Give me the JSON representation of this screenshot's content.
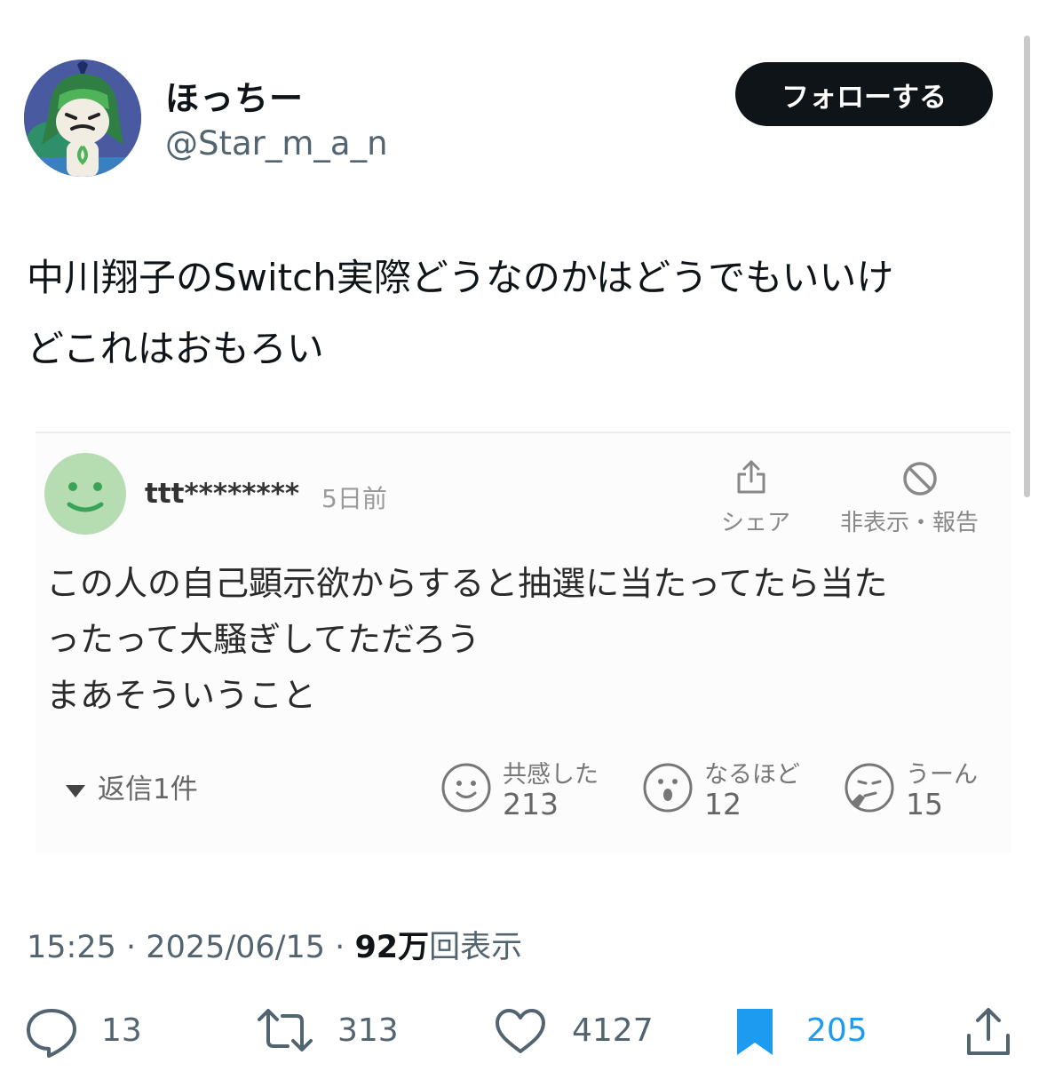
{
  "author": {
    "display_name": "ほっちー",
    "handle": "@Star_m_a_n",
    "follow_label": "フォローする"
  },
  "tweet": {
    "text_lines": [
      "中川翔子のSwitch実際どうなのかはどうでもいいけ",
      "どこれはおもろい"
    ]
  },
  "embedded_comment": {
    "username": "ttt********",
    "time": "5日前",
    "share_label": "シェア",
    "report_label": "非表示・報告",
    "body_lines": [
      "この人の自己顕示欲からすると抽選に当たってたら当た",
      "ったって大騒ぎしてただろう",
      "まあそういうこと"
    ],
    "replies_label": "返信1件",
    "reactions": [
      {
        "label": "共感した",
        "count": "213",
        "icon": "smile-icon"
      },
      {
        "label": "なるほど",
        "count": "12",
        "icon": "surprised-icon"
      },
      {
        "label": "うーん",
        "count": "15",
        "icon": "thinking-icon"
      }
    ]
  },
  "meta": {
    "time": "15:25",
    "date": "2025/06/15",
    "views_count": "92万",
    "views_label": "回表示",
    "separator": "·"
  },
  "actions": {
    "replies": "13",
    "retweets": "313",
    "likes": "4127",
    "bookmarks": "205"
  },
  "colors": {
    "text": "#0f1419",
    "secondary": "#536471",
    "accent": "#1d9bf0",
    "follow_bg": "#0f1419"
  }
}
